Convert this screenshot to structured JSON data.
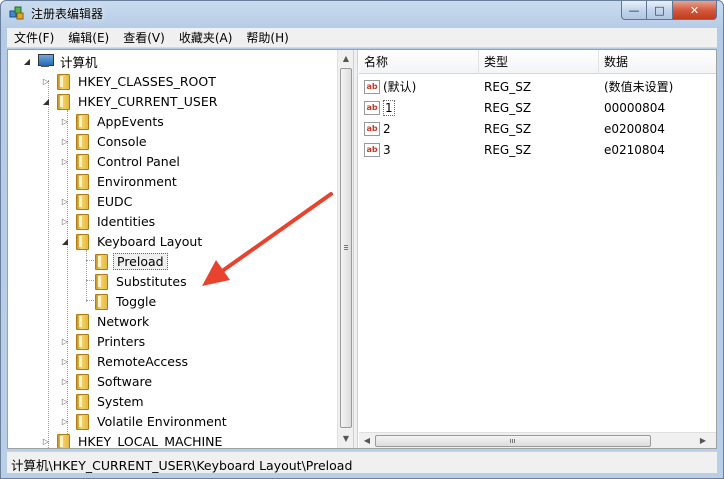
{
  "window": {
    "title": "注册表编辑器",
    "min_label": "—",
    "max_label": "□",
    "close_label": "✕"
  },
  "menu": [
    "文件(F)",
    "编辑(E)",
    "查看(V)",
    "收藏夹(A)",
    "帮助(H)"
  ],
  "tree": {
    "root": "计算机",
    "nodes": [
      {
        "label": "HKEY_CLASSES_ROOT",
        "expander": "▷"
      },
      {
        "label": "HKEY_CURRENT_USER",
        "expander": "◢"
      },
      {
        "label": "AppEvents",
        "expander": "▷"
      },
      {
        "label": "Console",
        "expander": "▷"
      },
      {
        "label": "Control Panel",
        "expander": "▷"
      },
      {
        "label": "Environment",
        "expander": ""
      },
      {
        "label": "EUDC",
        "expander": "▷"
      },
      {
        "label": "Identities",
        "expander": "▷"
      },
      {
        "label": "Keyboard Layout",
        "expander": "◢"
      },
      {
        "label": "Preload",
        "expander": ""
      },
      {
        "label": "Substitutes",
        "expander": ""
      },
      {
        "label": "Toggle",
        "expander": ""
      },
      {
        "label": "Network",
        "expander": ""
      },
      {
        "label": "Printers",
        "expander": "▷"
      },
      {
        "label": "RemoteAccess",
        "expander": "▷"
      },
      {
        "label": "Software",
        "expander": "▷"
      },
      {
        "label": "System",
        "expander": "▷"
      },
      {
        "label": "Volatile Environment",
        "expander": "▷"
      },
      {
        "label": "HKEY_LOCAL_MACHINE",
        "expander": "▷"
      }
    ]
  },
  "list": {
    "headers": {
      "name": "名称",
      "type": "类型",
      "data": "数据"
    },
    "rows": [
      {
        "name": "(默认)",
        "type": "REG_SZ",
        "data": "(数值未设置)"
      },
      {
        "name": "1",
        "type": "REG_SZ",
        "data": "00000804"
      },
      {
        "name": "2",
        "type": "REG_SZ",
        "data": "e0200804"
      },
      {
        "name": "3",
        "type": "REG_SZ",
        "data": "e0210804"
      }
    ],
    "value_icon": "ab"
  },
  "status": "计算机\\HKEY_CURRENT_USER\\Keyboard Layout\\Preload",
  "colors": {
    "arrow": "#e8432f"
  }
}
